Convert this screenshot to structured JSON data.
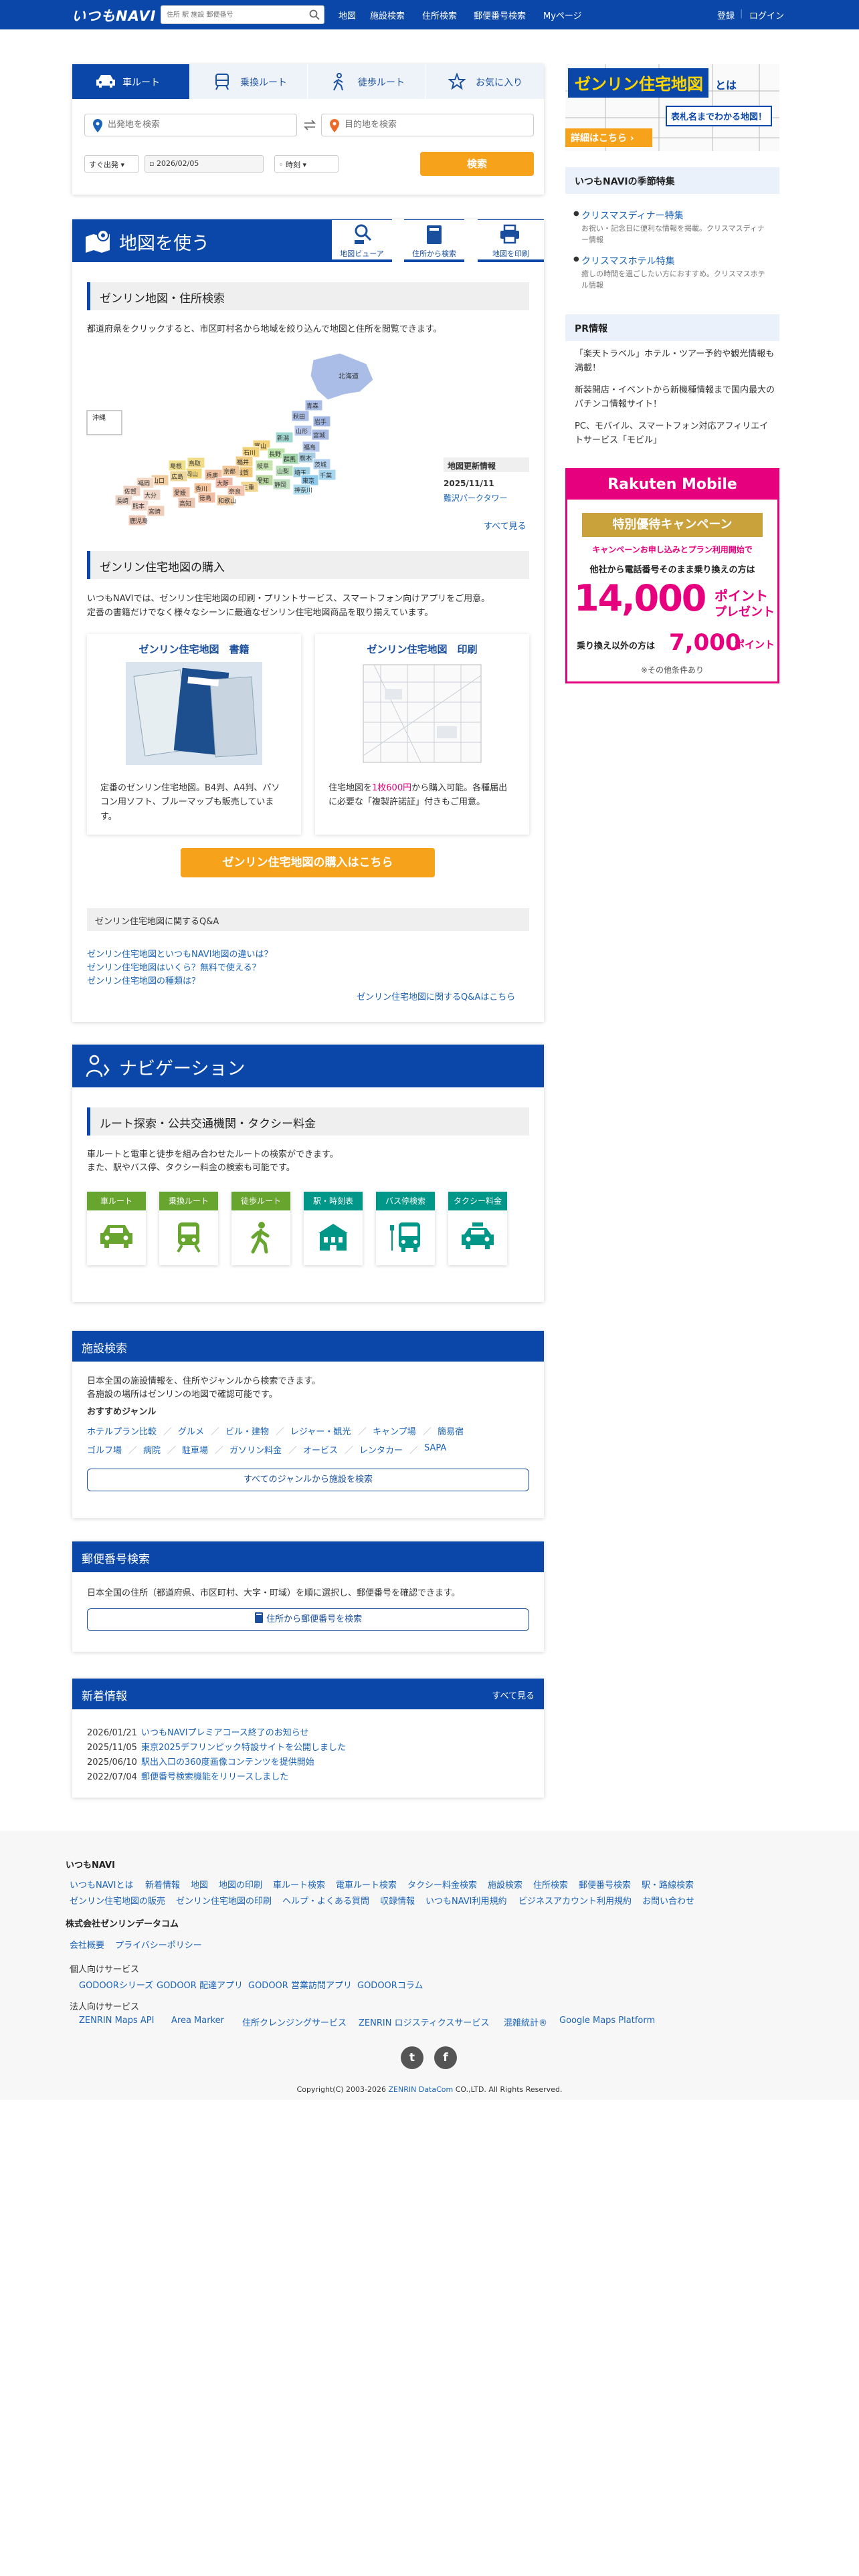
{
  "header": {
    "logo": "いつもNAVI",
    "search_placeholder": "住所 駅 施設 郵便番号",
    "nav": [
      "地図",
      "施設検索",
      "住所検索",
      "郵便番号検索",
      "Myページ"
    ],
    "login": "登録",
    "login2": "ログイン"
  },
  "route": {
    "tabs": [
      "車ルート",
      "乗換ルート",
      "徒歩ルート",
      "お気に入り"
    ],
    "from_placeholder": "出発地を検索",
    "to_placeholder": "目的地を検索",
    "when": "すぐ出発",
    "date": "2026/02/05",
    "time": "時刻",
    "search_label": "検索"
  },
  "map_section": {
    "title": "地図を使う",
    "buttons": [
      "地図ビューア",
      "住所から検索",
      "地図を印刷"
    ],
    "zenrin_heading": "ゼンリン地図・住所検索",
    "zenrin_desc": "都道府県をクリックすると、市区町村名から地域を絞り込んで地図と住所を閲覧できます。",
    "okinawa": "沖縄",
    "hokkaido": "北海道",
    "prefectures": [
      {
        "name": "青森"
      },
      {
        "name": "秋田"
      },
      {
        "name": "岩手"
      },
      {
        "name": "山形"
      },
      {
        "name": "宮城"
      },
      {
        "name": "新潟"
      },
      {
        "name": "福島"
      },
      {
        "name": "富山"
      },
      {
        "name": "石川"
      },
      {
        "name": "長野"
      },
      {
        "name": "群馬"
      },
      {
        "name": "栃木"
      },
      {
        "name": "茨城"
      },
      {
        "name": "福井"
      },
      {
        "name": "岐阜"
      },
      {
        "name": "山梨"
      },
      {
        "name": "埼玉"
      },
      {
        "name": "千葉"
      },
      {
        "name": "東京"
      },
      {
        "name": "神奈川"
      },
      {
        "name": "静岡"
      },
      {
        "name": "愛知"
      },
      {
        "name": "滋賀"
      },
      {
        "name": "京都"
      },
      {
        "name": "三重"
      },
      {
        "name": "兵庫"
      },
      {
        "name": "大阪"
      },
      {
        "name": "奈良"
      },
      {
        "name": "和歌山"
      },
      {
        "name": "鳥取"
      },
      {
        "name": "岡山"
      },
      {
        "name": "島根"
      },
      {
        "name": "広島"
      },
      {
        "name": "山口"
      },
      {
        "name": "香川"
      },
      {
        "name": "徳島"
      },
      {
        "name": "愛媛"
      },
      {
        "name": "高知"
      },
      {
        "name": "福岡"
      },
      {
        "name": "佐賀"
      },
      {
        "name": "大分"
      },
      {
        "name": "長崎"
      },
      {
        "name": "熊本"
      },
      {
        "name": "宮崎"
      },
      {
        "name": "鹿児島"
      }
    ],
    "update_title": "地図更新情報",
    "update_date": "2025/11/11",
    "update_item": "難沢パークタワー",
    "see_all": "すべて見る",
    "purchase_heading": "ゼンリン住宅地図の購入",
    "purchase_desc1": "いつもNAVIでは、ゼンリン住宅地図の印刷・プリントサービス、スマートフォン向けアプリをご用意。",
    "purchase_desc2": "定番の書籍だけでなく様々なシーンに最適なゼンリン住宅地図商品を取り揃えています。",
    "product1_title": "ゼンリン住宅地図　書籍",
    "product1_desc": "定番のゼンリン住宅地図。B4判、A4判、パソコン用ソフト、ブルーマップも販売しています。",
    "product2_title": "ゼンリン住宅地図　印刷",
    "product2_desc_a": "住宅地図を",
    "product2_price": "1枚600円",
    "product2_desc_b": "から購入可能。各種届出に必要な「複製許諾証」付きもご用意。",
    "buy_label": "ゼンリン住宅地図の購入はこちら",
    "qa_heading": "ゼンリン住宅地図に関するQ&A",
    "qa_links": [
      "ゼンリン住宅地図といつもNAVI地図の違いは？",
      "ゼンリン住宅地図はいくら？無料で使える？",
      "ゼンリン住宅地図の種類は？"
    ],
    "qa_all": "ゼンリン住宅地図に関するQ&Aはこちら"
  },
  "nav_section": {
    "title": "ナビゲーション",
    "heading": "ルート探索・公共交通機関・タクシー料金",
    "desc1": "車ルートと電車と徒歩を組み合わせたルートの検索ができます。",
    "desc2": "また、駅やバス停、タクシー料金の検索も可能です。",
    "buttons": [
      {
        "label": "車ルート",
        "color": "#67a52e"
      },
      {
        "label": "乗換ルート",
        "color": "#67a52e"
      },
      {
        "label": "徒歩ルート",
        "color": "#67a52e"
      },
      {
        "label": "駅・時刻表",
        "color": "#009688"
      },
      {
        "label": "バス停検索",
        "color": "#009688"
      },
      {
        "label": "タクシー料金",
        "color": "#009688"
      }
    ]
  },
  "facility": {
    "title": "施設検索",
    "desc1": "日本全国の施設情報を、住所やジャンルから検索できます。",
    "desc2": "各施設の場所はゼンリンの地図で確認可能です。",
    "genre_heading": "おすすめジャンル",
    "genres_row1": [
      "ホテルプラン比較",
      "グルメ",
      "ビル・建物",
      "レジャー・観光",
      "キャンプ場",
      "簡易宿"
    ],
    "genres_row2": [
      "ゴルフ場",
      "病院",
      "駐車場",
      "ガソリン料金",
      "オービス",
      "レンタカー",
      "SAPA"
    ],
    "all_genres": "すべてのジャンルから施設を検索"
  },
  "postal": {
    "title": "郵便番号検索",
    "desc": "日本全国の住所（都道府県、市区町村、大字・町域）を順に選択し、郵便番号を確認できます。",
    "button": "住所から郵便番号を検索"
  },
  "news": {
    "title": "新着情報",
    "see_all": "すべて見る",
    "items": [
      {
        "date": "2026/01/21",
        "text": "いつもNAVIプレミアコース終了のお知らせ"
      },
      {
        "date": "2025/11/05",
        "text": "東京2025デフリンピック特設サイトを公開しました"
      },
      {
        "date": "2025/06/10",
        "text": "駅出入口の360度画像コンテンツを提供開始"
      },
      {
        "date": "2022/07/04",
        "text": "郵便番号検索機能をリリースしました"
      }
    ]
  },
  "sidebar": {
    "banner_title_a": "ゼンリン住宅地図",
    "banner_title_b": "とは",
    "banner_sub": "表札名までわかる地図！",
    "banner_more": "詳細はこちら",
    "season_title": "いつもNAVIの季節特集",
    "season_items": [
      {
        "title": "クリスマスディナー特集",
        "desc": "お祝い・記念日に便利な情報を掲載。クリスマスディナー情報"
      },
      {
        "title": "クリスマスホテル特集",
        "desc": "癒しの時間を過ごしたい方におすすめ。クリスマスホテル情報"
      }
    ],
    "pr_title": "PR情報",
    "pr_items": [
      "「楽天トラベル」ホテル・ツアー予約や観光情報も満載！",
      "新装開店・イベントから新機種情報まで国内最大のパチンコ情報サイト！",
      "PC、モバイル、スマートフォン対応アフィリエイトサービス「モビル」"
    ],
    "rakuten": {
      "brand": "Rakuten Mobile",
      "campaign": "特別優待キャンペーン",
      "lead": "キャンペーンお申し込みとプラン利用開始で",
      "phone": "他社から電話番号そのまま乗り換えの方は",
      "amount1": "14,000",
      "unit": "ポイント",
      "present": "プレゼント",
      "other": "乗り換え以外の方は",
      "amount2": "7,000",
      "unit2": "ポイント",
      "note": "※その他条件あり"
    }
  },
  "footer": {
    "brand": "いつもNAVI",
    "links": [
      "いつもNAVIとは",
      "新着情報",
      "地図",
      "地図の印刷",
      "車ルート検索",
      "電車ルート検索",
      "タクシー料金検索",
      "施設検索",
      "住所検索",
      "郵便番号検索",
      "駅・路線検索"
    ],
    "links2": [
      "ゼンリン住宅地図の販売",
      "ゼンリン住宅地図の印刷",
      "ヘルプ・よくある質問",
      "収録情報",
      "いつもNAVI利用規約",
      "ビジネスアカウント利用規約",
      "お問い合わせ"
    ],
    "company": "株式会社ゼンリンデータコム",
    "company_links": [
      "会社概要",
      "プライバシーポリシー"
    ],
    "personal_h": "個人向けサービス",
    "personal": [
      "GODOORシリーズ",
      "GODOOR 配達アプリ",
      "GODOOR 営業訪問アプリ",
      "GODOORコラム"
    ],
    "corp_h": "法人向けサービス",
    "corp": [
      "ZENRIN Maps API",
      "Area Marker",
      "住所クレンジングサービス",
      "ZENRIN ロジスティクスサービス",
      "混雑統計®",
      "Google Maps Platform"
    ],
    "copy_a": "Copyright(C) 2003-2026 ",
    "copy_b": "ZENRIN DataCom",
    "copy_c": " CO.,LTD. All Rights Reserved."
  }
}
